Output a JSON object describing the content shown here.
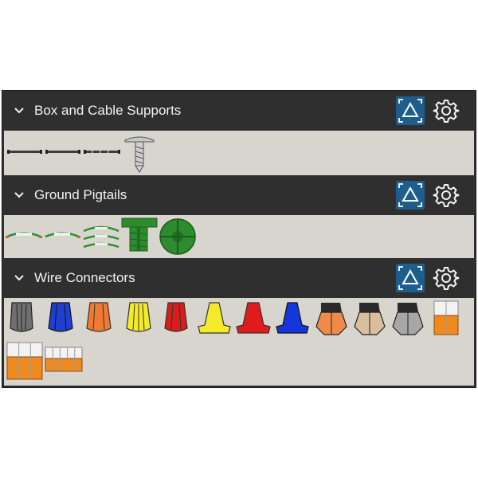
{
  "sections": [
    {
      "title": "Box and Cable Supports",
      "fit_icon": "fit-to-view-icon",
      "settings_icon": "gear-icon",
      "collapse_icon": "chevron-down-icon",
      "items": [
        "cable-support-bar-1",
        "cable-support-bar-2",
        "cable-support-bar-3",
        "support-screw"
      ]
    },
    {
      "title": "Ground Pigtails",
      "fit_icon": "fit-to-view-icon",
      "settings_icon": "gear-icon",
      "collapse_icon": "chevron-down-icon",
      "items": [
        "ground-pigtail-1",
        "ground-pigtail-2",
        "ground-pigtail-3",
        "green-ground-clip",
        "green-ground-disc"
      ]
    },
    {
      "title": "Wire Connectors",
      "fit_icon": "fit-to-view-icon",
      "settings_icon": "gear-icon",
      "collapse_icon": "chevron-down-icon",
      "items": [
        "gray",
        "blue",
        "orange",
        "yellow",
        "red",
        "yellow",
        "red",
        "blue",
        "orange-black",
        "tan-black",
        "gray-black",
        "lever-2",
        "lever-3",
        "lever-5"
      ]
    }
  ],
  "colors": {
    "panel_bg": "#2f2f2f",
    "tray_bg": "#d8d5ce",
    "accent": "#1e5e8c",
    "header_text": "#f2f2f2",
    "wire_green": "#2f8f2f",
    "lever_orange": "#f08a1c"
  }
}
